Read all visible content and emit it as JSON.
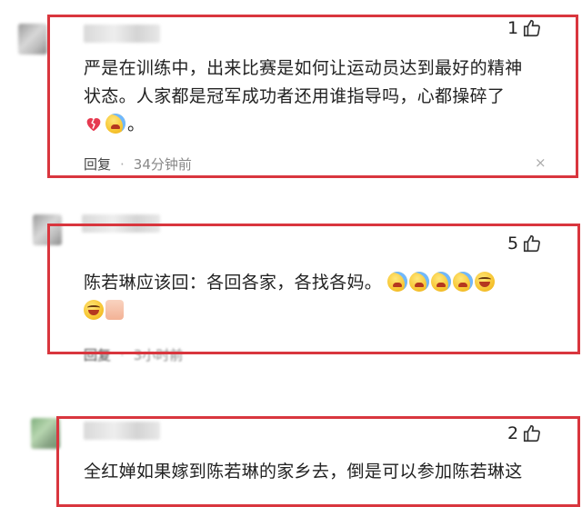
{
  "comments": [
    {
      "likes": "1",
      "text_lines": [
        "严是在训练中，出来比赛是如何让运动员达到最好的精神",
        "状态。人家都是冠军成功者还用谁指导吗，心都操碎了"
      ],
      "text_end": "。",
      "reply_label": "回复",
      "time": "34分钟前",
      "more": "×",
      "emojis": [
        "broken-heart",
        "crying-laugh"
      ]
    },
    {
      "likes": "5",
      "text_lines": [
        "陈若琳应该回：各回各家，各找各妈。"
      ],
      "reply_label": "回复",
      "time": "3小时前",
      "emojis_line1": [
        "rolling-laugh",
        "rolling-laugh",
        "crying-laugh",
        "crying-laugh",
        "grin-laugh"
      ],
      "emojis_line2": [
        "grin-laugh",
        "thumbs-up"
      ]
    },
    {
      "likes": "2",
      "text_lines": [
        "全红婵如果嫁到陈若琳的家乡去，倒是可以参加陈若琳这"
      ]
    }
  ],
  "colors": {
    "highlight_border": "#d9363e",
    "meta_text": "#888888"
  }
}
